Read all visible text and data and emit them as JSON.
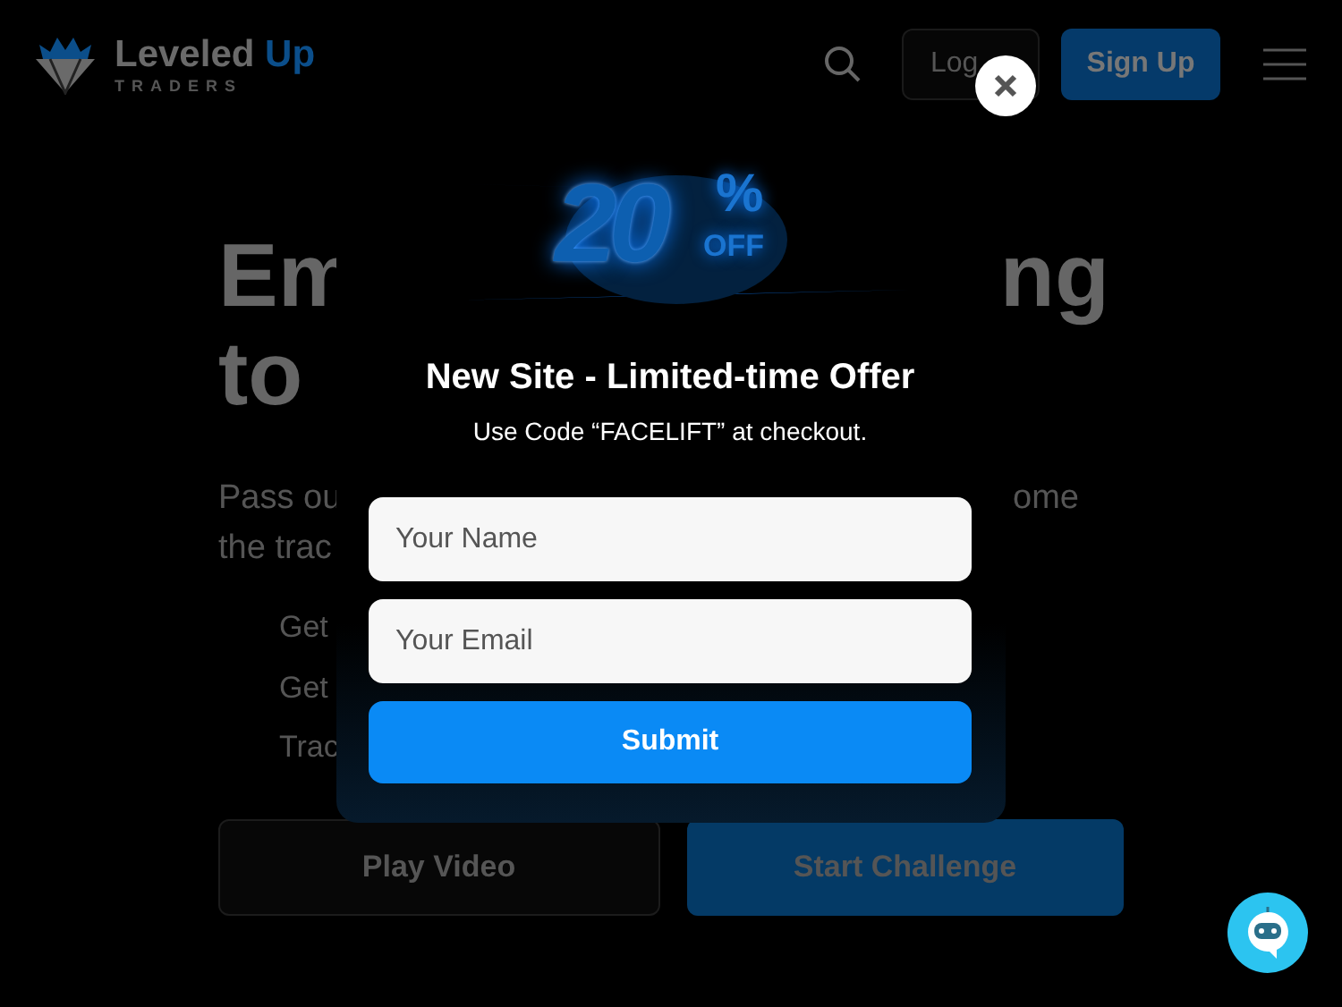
{
  "header": {
    "logo_text": "Leveled",
    "logo_accent": "Up",
    "logo_sub": "TRADERS",
    "login": "Log",
    "signup": "Sign Up"
  },
  "hero": {
    "heading_line1": [
      "Em",
      "ng"
    ],
    "heading_line2": "to",
    "paragraph_line1": [
      "Pass ou",
      "ome"
    ],
    "paragraph_line2": "the trac",
    "list_items": [
      "Get",
      "Get",
      "Trac"
    ],
    "buttons": [
      {
        "label": "Play Video",
        "kind": "secondary"
      },
      {
        "label": "Start Challenge",
        "kind": "primary"
      }
    ]
  },
  "modal": {
    "badge_number": "20",
    "badge_percent": "%",
    "badge_off": "OFF",
    "title": "New Site - Limited-time Offer",
    "subtitle": "Use Code “FACELIFT” at checkout.",
    "fields": [
      {
        "placeholder": "Your Name"
      },
      {
        "placeholder": "Your Email"
      }
    ],
    "submit": "Submit"
  }
}
